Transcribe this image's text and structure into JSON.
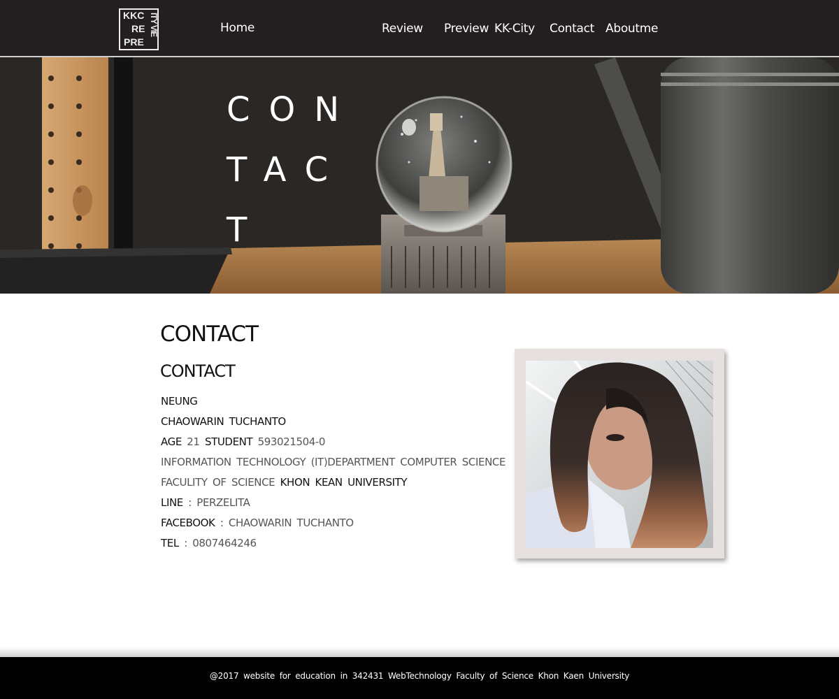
{
  "logo": {
    "line1": "KKC",
    "line2": "RE",
    "line3": "PRE",
    "vertical": "ITY VIE"
  },
  "nav": {
    "home": "Home",
    "review": "Review",
    "preview": "Preview",
    "kkcity": "KK-City",
    "contact": "Contact",
    "aboutme": "Aboutme"
  },
  "hero": {
    "title": "CONTACT"
  },
  "content": {
    "title": "CONTACT",
    "subtitle": "CONTACT",
    "nickname": "NEUNG",
    "full_name": "CHAOWARIN TUCHANTO",
    "age_label": "AGE",
    "age_value": "21",
    "student_label": "STUDENT",
    "student_value": "593021504-0",
    "department": "INFORMATION TECHNOLOGY (IT)DEPARTMENT COMPUTER SCIENCE",
    "faculty": "FACULITY OF SCIENCE",
    "university": "KHON KEAN UNIVERSITY",
    "line_label": "LINE",
    "line_value": "PERZELITA",
    "facebook_label": "FACEBOOK",
    "facebook_value": "CHAOWARIN TUCHANTO",
    "tel_label": "TEL",
    "tel_value": "0807464246",
    "separator": ":"
  },
  "footer": {
    "text": "@2017 website for education in 342431 WebTechnology Faculty of Science Khon Kaen University"
  },
  "colors": {
    "navbar": "#231f20",
    "footer": "#000000",
    "photo_frame": "#e6e0de"
  }
}
